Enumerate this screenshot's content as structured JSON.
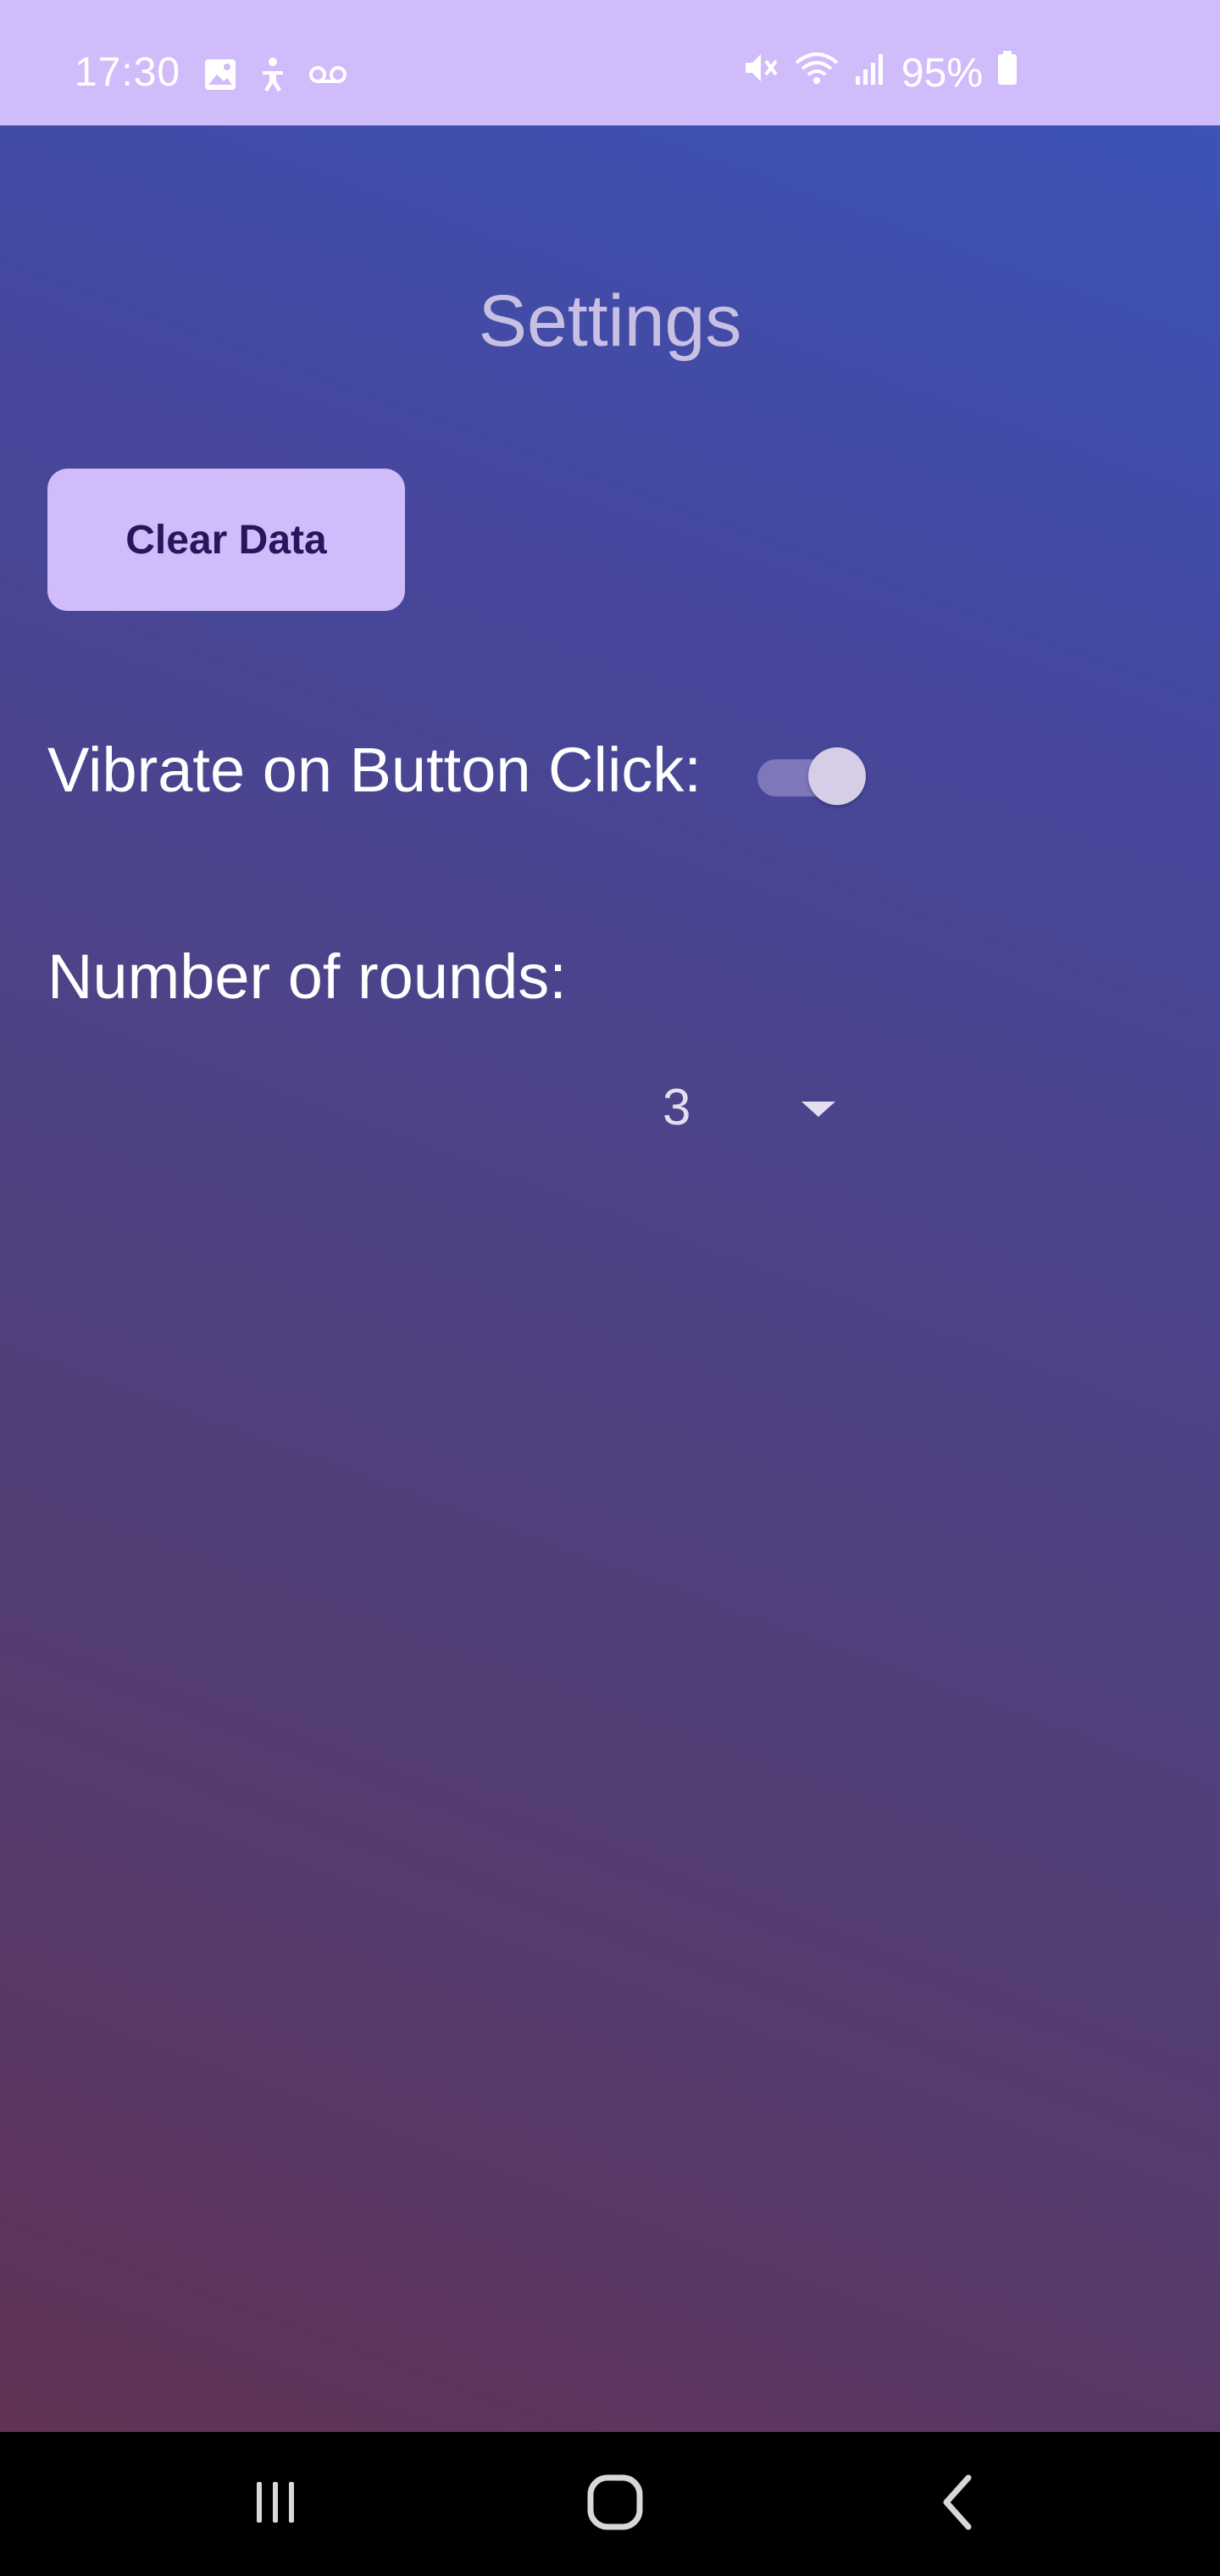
{
  "status_bar": {
    "time": "17:30",
    "battery": "95%",
    "left_icons": [
      "image-icon",
      "accessibility-icon",
      "voicemail-icon"
    ],
    "right_icons": [
      "mute-icon",
      "wifi-icon",
      "signal-icon",
      "battery-icon"
    ]
  },
  "page": {
    "title": "Settings"
  },
  "actions": {
    "clear_data_label": "Clear Data"
  },
  "settings": {
    "vibrate_label": "Vibrate on Button Click:",
    "vibrate_enabled": true,
    "rounds_label": "Number of rounds:",
    "rounds_value": "3"
  },
  "nav_bar": {
    "buttons": [
      "recents-icon",
      "home-icon",
      "back-icon"
    ]
  },
  "colors": {
    "accent": "#d1bcfb",
    "button_text": "#29145e",
    "gradient_top": "#3c53b7",
    "gradient_bottom": "#613253"
  }
}
